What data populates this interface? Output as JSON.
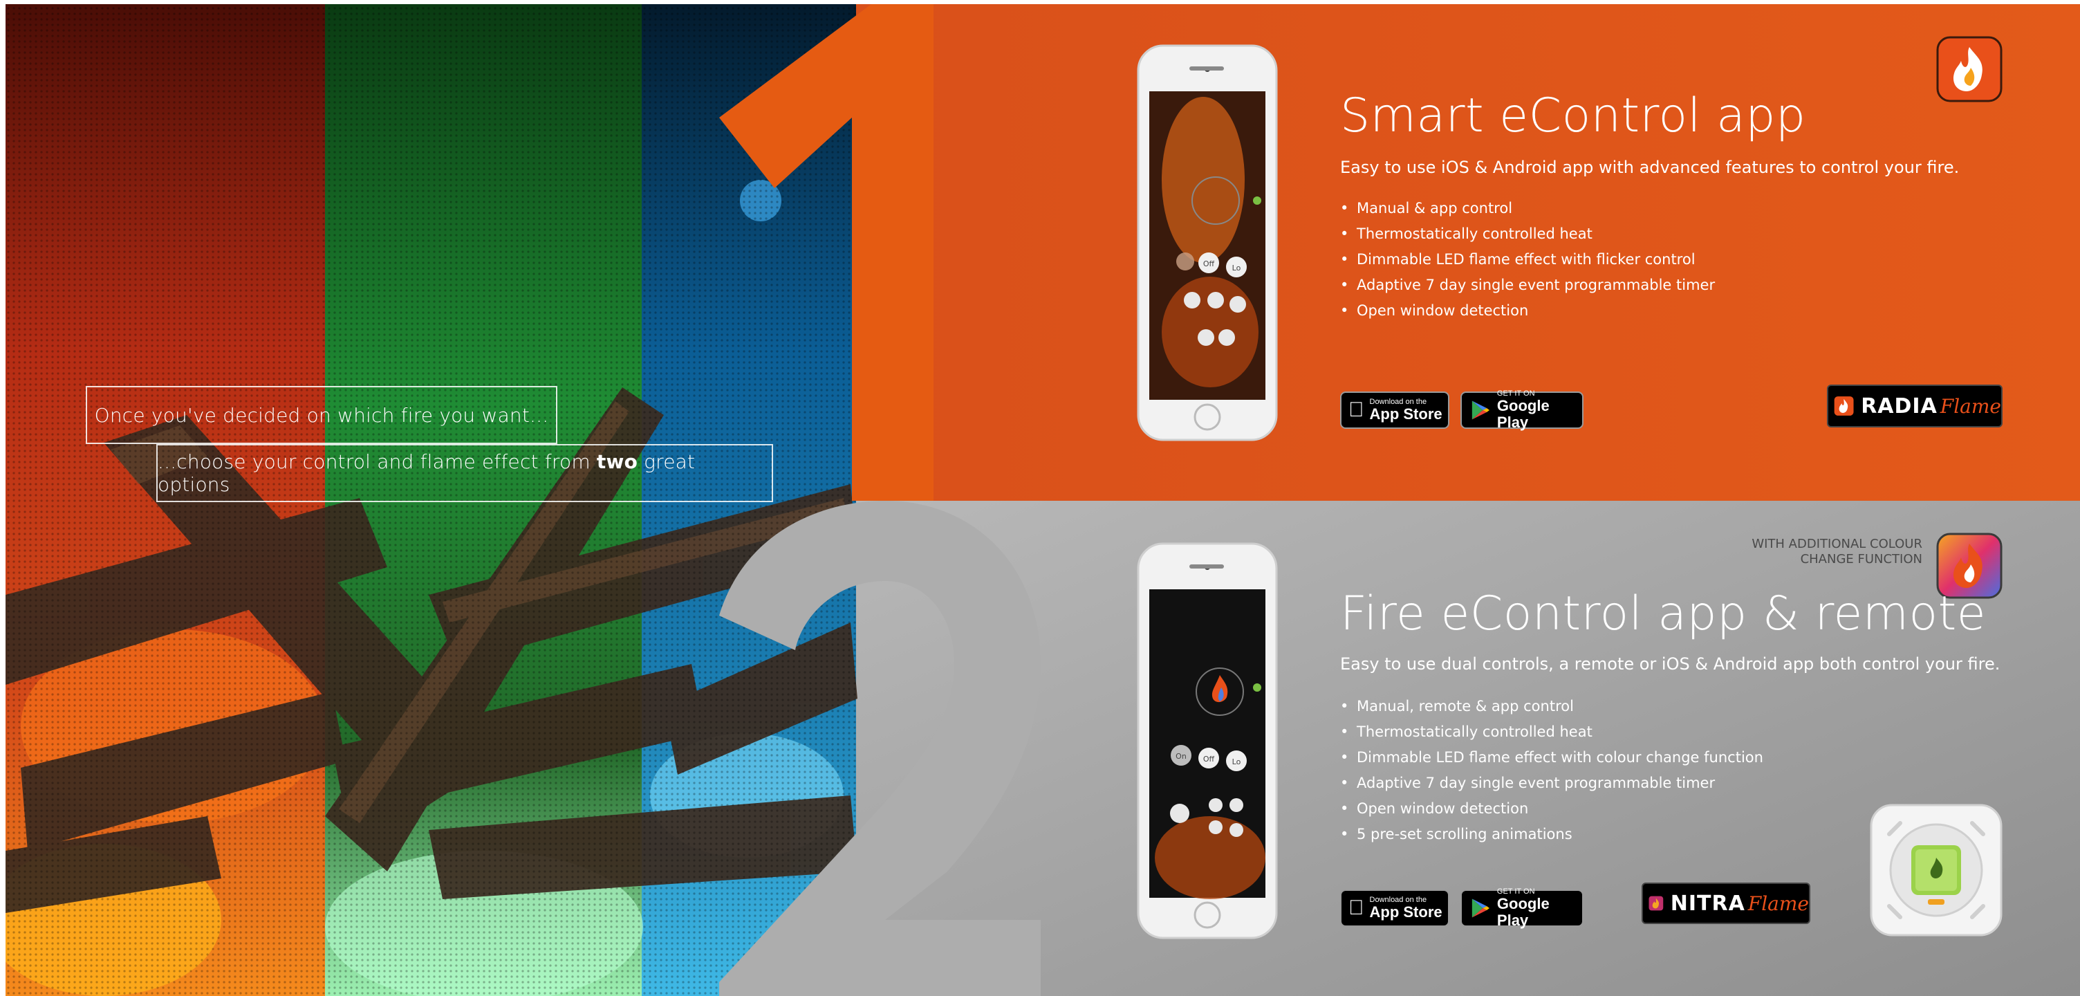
{
  "tagline": {
    "line1": "Once you've decided on which fire you want...",
    "line2_prefix": "...choose your control and flame effect from ",
    "line2_bold": "two",
    "line2_suffix": " great options"
  },
  "options": [
    {
      "number": "1",
      "title": "Smart eControl app",
      "subtitle": "Easy to use iOS & Android app with advanced features to control your fire.",
      "features": [
        "Manual & app control",
        "Thermostatically controlled heat",
        "Dimmable LED flame effect with flicker control",
        "Adaptive 7 day single event programmable timer",
        "Open window detection"
      ],
      "app_store": {
        "small": "Download on the",
        "big": "App Store"
      },
      "google_play": {
        "small": "GET IT ON",
        "big": "Google Play"
      },
      "brand": {
        "name": "RADIA",
        "script": "Flame"
      },
      "accent": "#e0571a"
    },
    {
      "number": "2",
      "title": "Fire eControl app & remote",
      "subtitle": "Easy to use dual controls, a remote or iOS & Android app both control your fire.",
      "note": "WITH ADDITIONAL COLOUR\nCHANGE FUNCTION",
      "features": [
        "Manual, remote & app control",
        "Thermostatically controlled heat",
        "Dimmable LED flame effect with colour change function",
        "Adaptive 7 day single event programmable timer",
        "Open window detection",
        "5 pre-set scrolling animations"
      ],
      "app_store": {
        "small": "Download on the",
        "big": "App Store"
      },
      "google_play": {
        "small": "GET IT ON",
        "big": "Google Play"
      },
      "brand": {
        "name": "NITRA",
        "script": "Flame"
      },
      "accent": "#a7a7a7"
    }
  ],
  "phone_screens": {
    "phone1": {
      "buttons": [
        "Off",
        "Lo"
      ]
    },
    "phone2": {
      "buttons": [
        "On",
        "Off",
        "Lo"
      ]
    }
  },
  "colors": {
    "orange": "#e0571a",
    "grey": "#a8a8a8",
    "fire_red": "#c7321b",
    "fire_green": "#2fa84a",
    "fire_blue": "#1e88c8"
  }
}
